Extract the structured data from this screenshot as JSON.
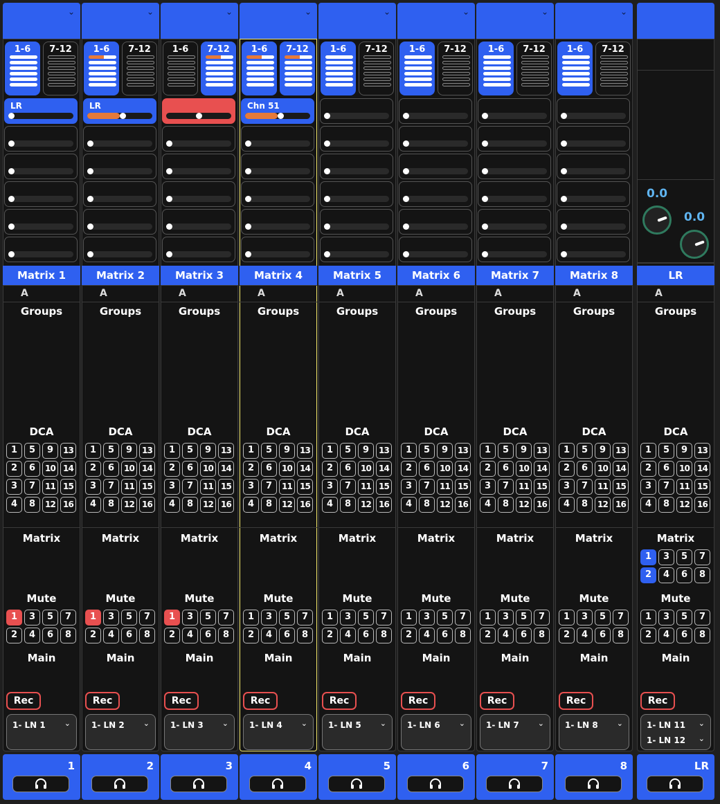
{
  "strips": [
    {
      "name": "Matrix 1",
      "number": "1",
      "selected": false,
      "bank_active": "1-6",
      "sends": [
        {
          "label": "LR",
          "style": "blue",
          "level": 0.0
        },
        {},
        {},
        {},
        {},
        {}
      ],
      "mute_on": [
        "1"
      ],
      "selector": [
        "1- LN 1"
      ]
    },
    {
      "name": "Matrix 2",
      "number": "2",
      "selected": false,
      "bank_active": "1-6",
      "sends": [
        {
          "label": "LR",
          "style": "blue",
          "level": 0.55
        },
        {},
        {},
        {},
        {},
        {}
      ],
      "mute_on": [
        "1"
      ],
      "selector": [
        "1- LN 2"
      ]
    },
    {
      "name": "Matrix 3",
      "number": "3",
      "selected": false,
      "bank_active": "7-12",
      "sends": [
        {
          "label": "",
          "style": "red",
          "level": 0.5
        },
        {},
        {},
        {},
        {},
        {}
      ],
      "mute_on": [
        "1"
      ],
      "selector": [
        "1- LN 3"
      ]
    },
    {
      "name": "Matrix 4",
      "number": "4",
      "selected": true,
      "bank_active": "both",
      "sends": [
        {
          "label": "Chn 51",
          "style": "blue",
          "level": 0.55
        },
        {},
        {},
        {},
        {},
        {}
      ],
      "mute_on": [],
      "selector": [
        "1- LN 4"
      ]
    },
    {
      "name": "Matrix 5",
      "number": "5",
      "selected": false,
      "bank_active": "1-6",
      "sends": [
        {},
        {},
        {},
        {},
        {},
        {}
      ],
      "mute_on": [],
      "selector": [
        "1- LN 5"
      ]
    },
    {
      "name": "Matrix 6",
      "number": "6",
      "selected": false,
      "bank_active": "1-6",
      "sends": [
        {},
        {},
        {},
        {},
        {},
        {}
      ],
      "mute_on": [],
      "selector": [
        "1- LN 6"
      ]
    },
    {
      "name": "Matrix 7",
      "number": "7",
      "selected": false,
      "bank_active": "1-6",
      "sends": [
        {},
        {},
        {},
        {},
        {},
        {}
      ],
      "mute_on": [],
      "selector": [
        "1- LN 7"
      ]
    },
    {
      "name": "Matrix 8",
      "number": "8",
      "selected": false,
      "bank_active": "1-6",
      "sends": [
        {},
        {},
        {},
        {},
        {},
        {}
      ],
      "mute_on": [],
      "selector": [
        "1- LN 8"
      ]
    }
  ],
  "lr_strip": {
    "name": "LR",
    "number": "LR",
    "knob_values": [
      "0.0",
      "0.0"
    ],
    "matrix_on": [
      "1",
      "2"
    ],
    "selector": [
      "1- LN 11",
      "1- LN 12"
    ]
  },
  "labels": {
    "bank_a": "1-6",
    "bank_b": "7-12",
    "group_letter": "A",
    "groups": "Groups",
    "dca": "DCA",
    "matrix": "Matrix",
    "mute": "Mute",
    "main": "Main",
    "rec": "Rec"
  },
  "dca_numbers": [
    "1",
    "5",
    "9",
    "13",
    "2",
    "6",
    "10",
    "14",
    "3",
    "7",
    "11",
    "15",
    "4",
    "8",
    "12",
    "16"
  ],
  "mute_numbers": [
    "1",
    "3",
    "5",
    "7",
    "2",
    "4",
    "6",
    "8"
  ],
  "icons": {
    "dropdown": "chevron-down-icon",
    "listen": "headphones-icon",
    "knob": "knob-icon"
  },
  "colors": {
    "accent": "#2f60f0",
    "mute": "#e85050",
    "send_level": "#e67a3a",
    "knob_value": "#5fb4f0",
    "selected_outline": "#f3e86a"
  }
}
